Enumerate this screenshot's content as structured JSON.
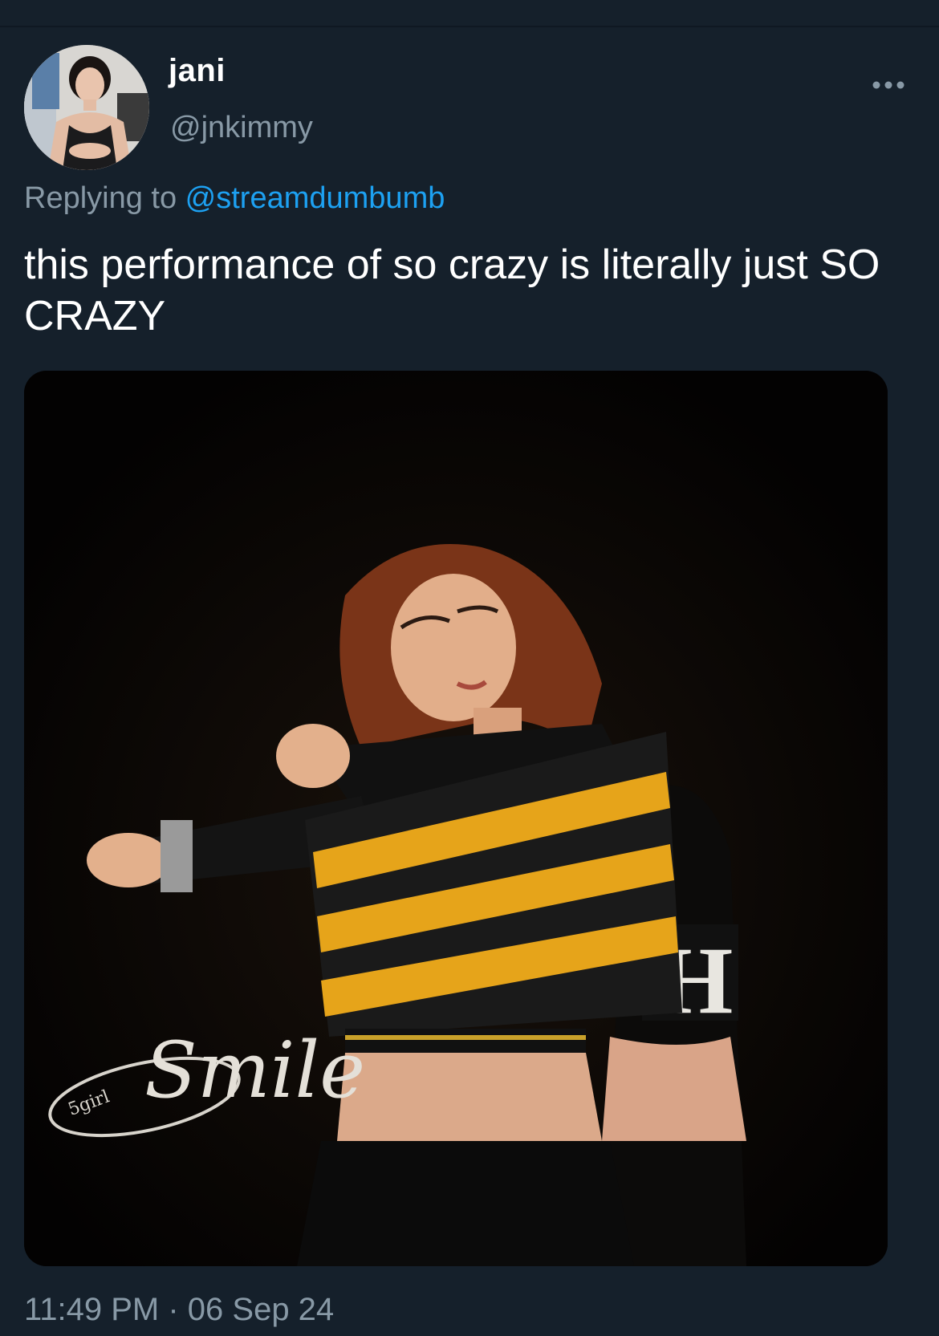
{
  "tweet": {
    "author": {
      "display_name": "jani",
      "handle": "@jnkimmy",
      "avatar_icon": "profile-photo"
    },
    "more_icon": "ellipsis-icon",
    "reply": {
      "prefix": "Replying to ",
      "mention": "@streamdumbumb"
    },
    "text": "this performance of so crazy is literally just SO CRAZY",
    "media": {
      "kind": "photo",
      "watermark_text": "Smile",
      "watermark_small": "5girl"
    },
    "timestamp": "11:49 PM · 06 Sep 24"
  },
  "colors": {
    "background": "#15202b",
    "primary_text": "#ffffff",
    "secondary_text": "#8899a6",
    "link": "#1da1f2"
  }
}
